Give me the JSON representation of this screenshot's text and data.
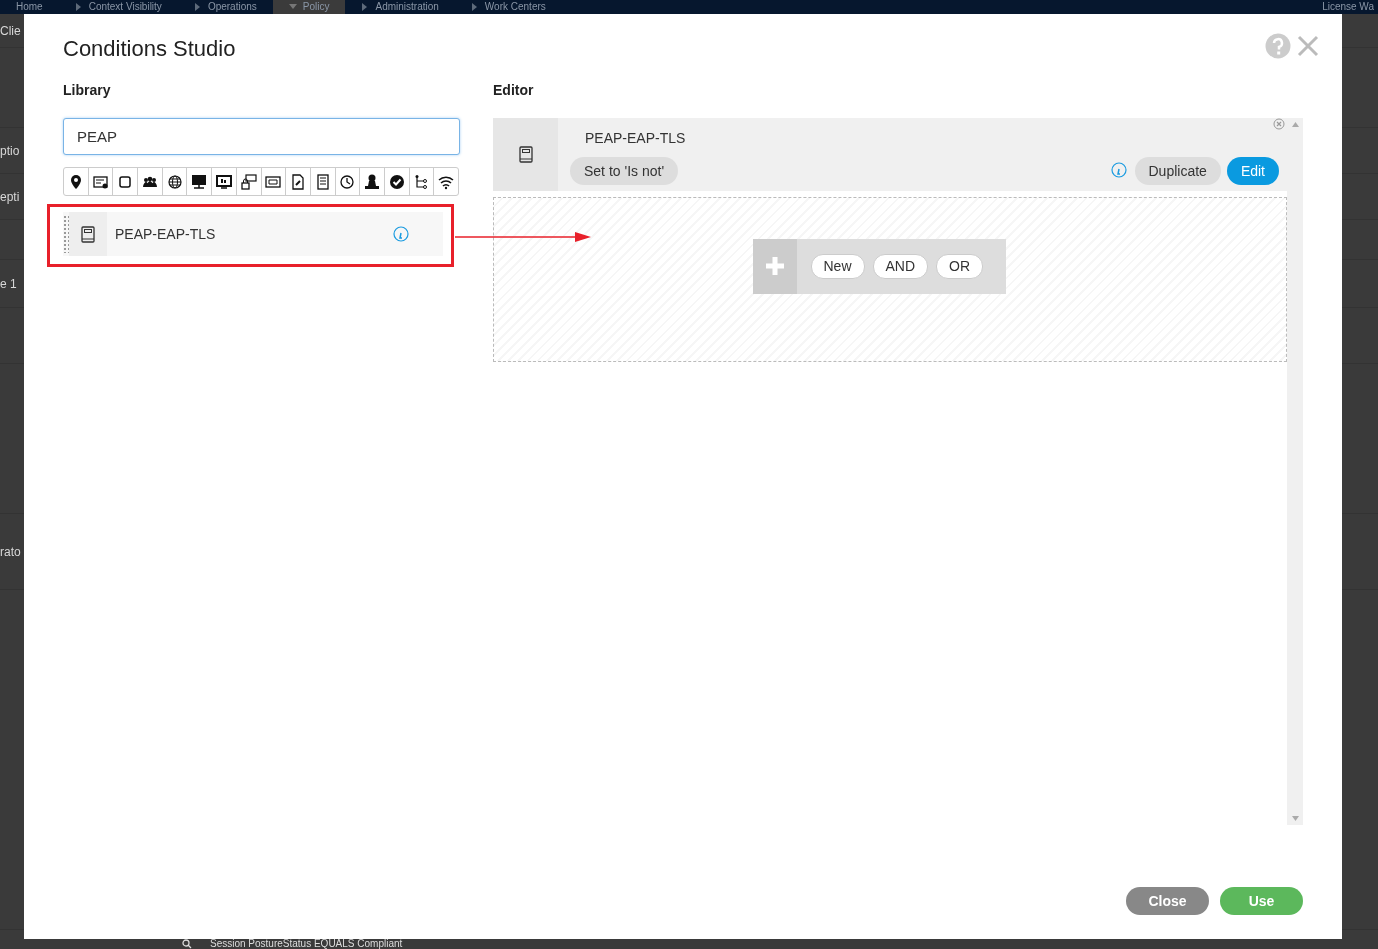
{
  "background": {
    "nav_items": [
      {
        "label": "Home",
        "selected": false
      },
      {
        "label": "Context Visibility",
        "selected": false
      },
      {
        "label": "Operations",
        "selected": false
      },
      {
        "label": "Policy",
        "selected": true
      },
      {
        "label": "Administration",
        "selected": false
      },
      {
        "label": "Work Centers",
        "selected": false
      }
    ],
    "nav_right": "License Wa",
    "row_fragments": [
      "Clie",
      "ptio",
      "epti",
      "e 1",
      "rato"
    ],
    "footer_text": "Session PostureStatus EQUALS Compliant"
  },
  "dialog": {
    "title": "Conditions Studio",
    "library": {
      "heading": "Library",
      "search": {
        "value": "PEAP"
      },
      "results": [
        {
          "label": "PEAP-EAP-TLS",
          "highlighted": true
        }
      ]
    },
    "editor": {
      "heading": "Editor",
      "condition": {
        "name": "PEAP-EAP-TLS",
        "set_to": "Set to 'Is not'",
        "actions": [
          {
            "label": "Duplicate",
            "kind": "secondary"
          },
          {
            "label": "Edit",
            "kind": "primary"
          }
        ]
      },
      "drop_zone": {
        "buttons": [
          "New",
          "AND",
          "OR"
        ]
      }
    },
    "buttons": [
      {
        "label": "Close",
        "kind": "secondary"
      },
      {
        "label": "Use",
        "kind": "primary"
      }
    ]
  }
}
